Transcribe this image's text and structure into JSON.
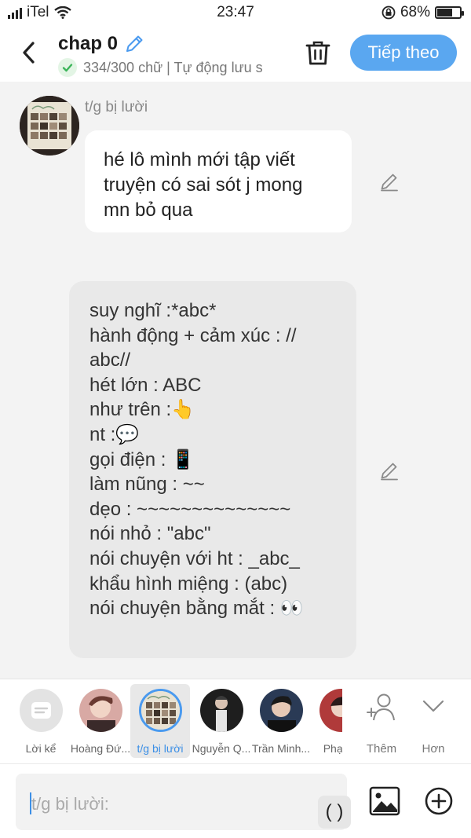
{
  "status": {
    "carrier": "iTel",
    "time": "23:47",
    "battery": "68%",
    "battery_level": 0.68
  },
  "header": {
    "title": "chap 0",
    "subtitle": "334/300 chữ | Tự động lưu s",
    "next_label": "Tiếp theo"
  },
  "messages": [
    {
      "author": "t/g bị lười",
      "text": "hé lô mình mới tập viết truyện có sai sót j mong mn bỏ qua"
    },
    {
      "lines": [
        "suy nghĩ :*abc*",
        "hành động + cảm xúc : //",
        "abc//",
        "hét lớn : ABC",
        "như trên :👆",
        "nt :💬",
        "gọi điện : 📱",
        "làm nũng : ~~",
        "dẹo : ~~~~~~~~~~~~~~",
        "nói nhỏ : \"abc\"",
        "nói chuyện với ht : _abc_",
        "khẩu hình miệng :  (abc)",
        "nói chuyện bằng mắt : 👀"
      ]
    }
  ],
  "characters": [
    {
      "label": "Lời kể"
    },
    {
      "label": "Hoàng Đứ..."
    },
    {
      "label": "t/g bị lười"
    },
    {
      "label": "Nguyễn Q..."
    },
    {
      "label": "Trần Minh..."
    },
    {
      "label": "Phạm"
    }
  ],
  "actions": {
    "add_label": "Thêm",
    "more_label": "Hơn"
  },
  "input": {
    "placeholder": "t/g bị lười:",
    "paren_label": "( )"
  },
  "colors": {
    "accent": "#5aa7f0",
    "selected": "#3c8fe6"
  }
}
